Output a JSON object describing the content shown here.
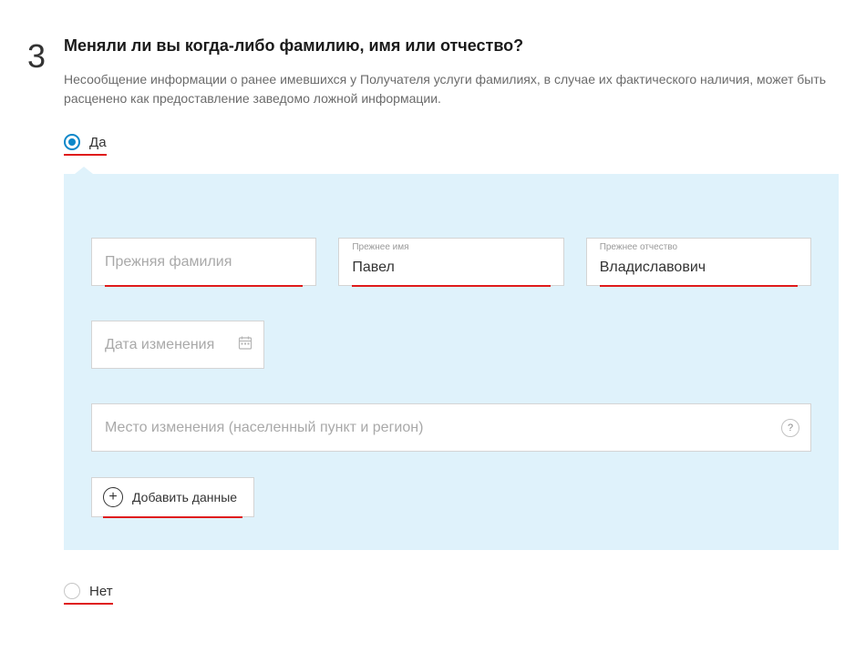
{
  "step": "3",
  "question_title": "Меняли ли вы когда-либо фамилию, имя или отчество?",
  "question_desc": "Несообщение информации о ранее имевшихся у Получателя услуги фамилиях, в случае их фактического наличия, может быть расценено как предоставление заведомо ложной информации.",
  "radio_yes": "Да",
  "radio_no": "Нет",
  "fields": {
    "surname": {
      "placeholder": "Прежняя фамилия"
    },
    "firstname": {
      "label": "Прежнее имя",
      "value": "Павел"
    },
    "patronymic": {
      "label": "Прежнее отчество",
      "value": "Владиславович"
    },
    "date": {
      "placeholder": "Дата изменения"
    },
    "place": {
      "placeholder": "Место изменения (населенный пункт и регион)"
    }
  },
  "add_button_label": "Добавить данные",
  "help_char": "?"
}
